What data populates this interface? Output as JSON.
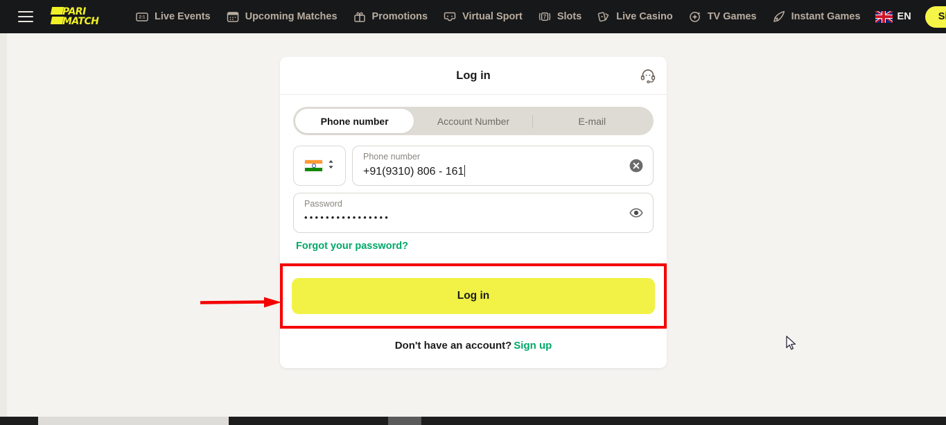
{
  "nav": {
    "burger_label": "menu",
    "brand": {
      "line1": "PARI",
      "line2": "MATCH"
    },
    "items": [
      {
        "label": "Live Events",
        "icon": "scoreboard-icon"
      },
      {
        "label": "Upcoming Matches",
        "icon": "calendar-icon"
      },
      {
        "label": "Promotions",
        "icon": "gift-icon"
      },
      {
        "label": "Virtual Sport",
        "icon": "gamepad-icon"
      },
      {
        "label": "Slots",
        "icon": "slot-seven-icon"
      },
      {
        "label": "Live Casino",
        "icon": "playing-cards-icon"
      },
      {
        "label": "TV Games",
        "icon": "sparkle-circle-icon"
      },
      {
        "label": "Instant Games",
        "icon": "rocket-icon"
      }
    ],
    "language": {
      "label": "EN",
      "icon": "uk-flag-icon"
    },
    "signup_label": "Sign up"
  },
  "card": {
    "title": "Log in",
    "support_icon": "headset-support-icon",
    "tabs": [
      {
        "label": "Phone number",
        "active": true
      },
      {
        "label": "Account Number",
        "active": false
      },
      {
        "label": "E-mail",
        "active": false
      }
    ],
    "country_select": {
      "flag": "india-flag-icon",
      "chevron": "chevron-up-down-icon"
    },
    "phone_field": {
      "label": "Phone number",
      "value": "+91(9310) 806 - 161",
      "placeholder": "Phone number",
      "action_icon": "clear-circle-x-icon"
    },
    "password_field": {
      "label": "Password",
      "value": "••••••••••••••••",
      "placeholder": "Password",
      "action_icon": "eye-show-icon"
    },
    "forgot_label": "Forgot your password?",
    "login_label": "Log in",
    "footer": {
      "text": "Don't have an account?",
      "link": "Sign up"
    }
  },
  "annotation": {
    "arrow_icon": "red-arrow-right-icon",
    "highlight_color": "#f50000"
  },
  "cursor": {
    "icon": "mouse-pointer-icon"
  },
  "colors": {
    "brand_yellow": "#f5f547",
    "accent_green": "#00a868",
    "nav_bg": "#17181a",
    "page_bg": "#f4f3f0",
    "annotation_red": "#f50000"
  }
}
